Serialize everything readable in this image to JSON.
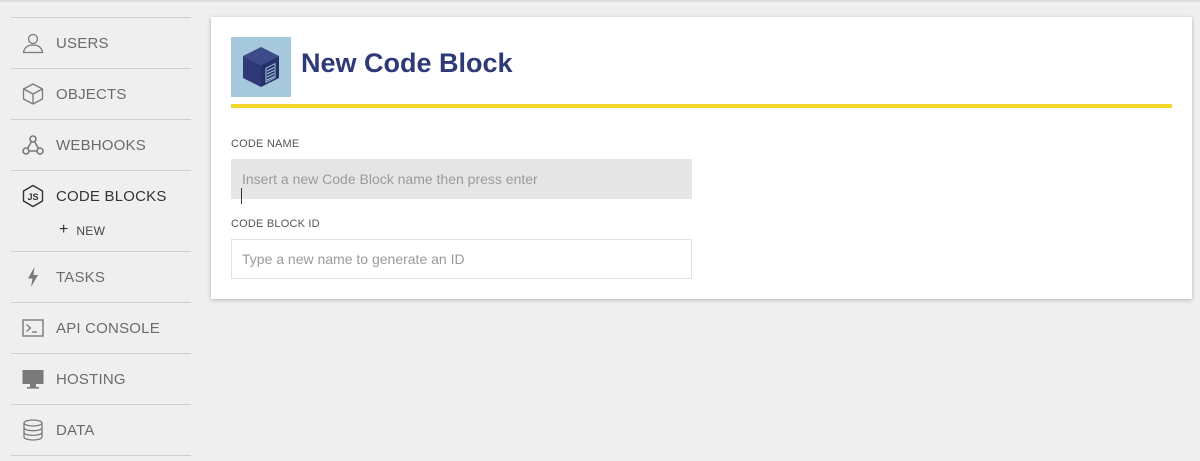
{
  "sidebar": {
    "items": [
      {
        "label": "USERS",
        "icon": "user-icon"
      },
      {
        "label": "OBJECTS",
        "icon": "cube-icon"
      },
      {
        "label": "WEBHOOKS",
        "icon": "webhook-icon"
      },
      {
        "label": "CODE BLOCKS",
        "icon": "js-icon",
        "active": true,
        "sub": [
          {
            "label": "NEW",
            "icon": "plus-icon"
          }
        ]
      },
      {
        "label": "TASKS",
        "icon": "lightning-icon"
      },
      {
        "label": "API CONSOLE",
        "icon": "terminal-icon"
      },
      {
        "label": "HOSTING",
        "icon": "monitor-icon"
      },
      {
        "label": "DATA",
        "icon": "database-icon"
      }
    ]
  },
  "card": {
    "title": "New Code Block",
    "logo_icon": "code-block-cube-icon",
    "fields": {
      "code_name": {
        "label": "CODE NAME",
        "value": "",
        "placeholder": "Insert a new Code Block name then press enter"
      },
      "code_block_id": {
        "label": "CODE BLOCK ID",
        "value": "",
        "placeholder": "Type a new name to generate an ID"
      }
    }
  },
  "colors": {
    "accent_rule": "#f3d72a",
    "title": "#2e3a78",
    "logo_bg": "#a6c8dc",
    "page_bg": "#efefef"
  }
}
